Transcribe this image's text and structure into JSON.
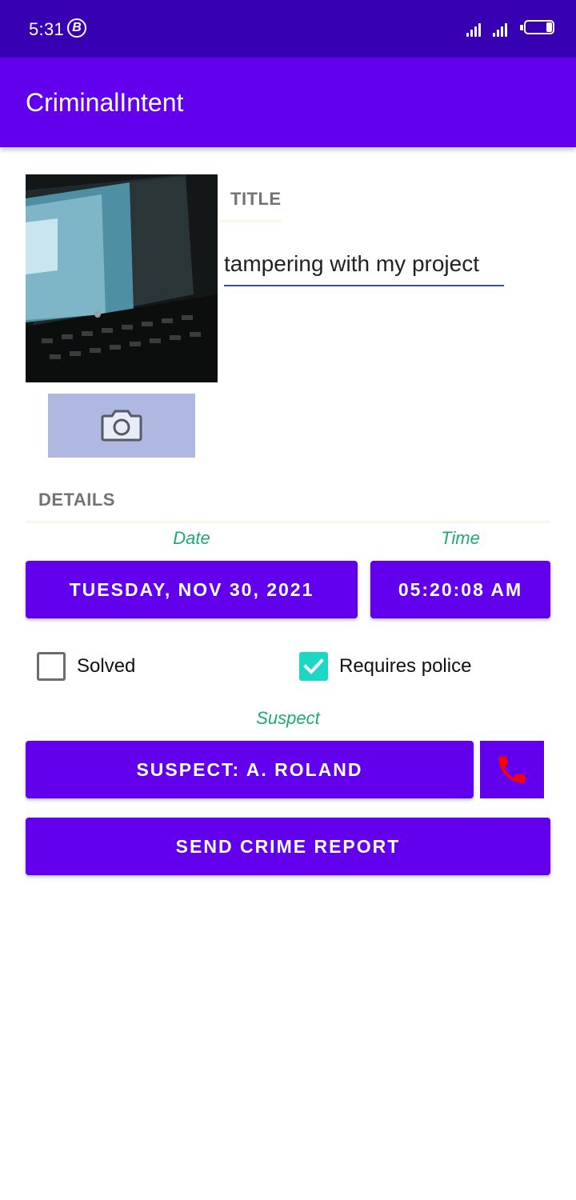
{
  "status_bar": {
    "time": "5:31",
    "badge_letter": "B"
  },
  "app_bar": {
    "title": "CriminalIntent"
  },
  "crime": {
    "title_header": "TITLE",
    "title_value": "tampering with my project",
    "details_header": "DETAILS",
    "date_label": "Date",
    "date_value": "TUESDAY, NOV 30, 2021",
    "time_label": "Time",
    "time_value": "05:20:08 AM",
    "solved_label": "Solved",
    "solved_checked": false,
    "requires_police_label": "Requires police",
    "requires_police_checked": true,
    "suspect_label": "Suspect",
    "suspect_button": "SUSPECT: A. ROLAND",
    "report_button": "SEND CRIME REPORT"
  },
  "icons": {
    "camera": "camera-icon",
    "call": "phone-icon",
    "check": "check-icon"
  },
  "colors": {
    "status_bar": "#3700b3",
    "primary": "#6200ee",
    "label_accent": "#1ea77a",
    "checkbox_checked": "#1ad8c4",
    "call_icon": "#ff0000",
    "camera_button_bg": "#aeb8e0"
  }
}
